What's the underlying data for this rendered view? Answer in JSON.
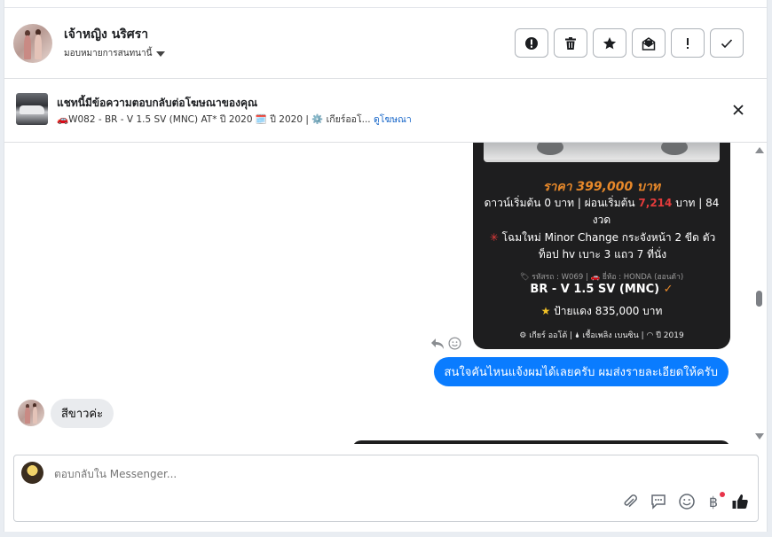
{
  "header": {
    "name": "เจ้าหญิง นริศรา",
    "assign_label": "มอบหมายการสนทนานี้",
    "actions": [
      {
        "icon": "alert-circle-icon"
      },
      {
        "icon": "trash-icon"
      },
      {
        "icon": "star-icon"
      },
      {
        "icon": "mark-unread-icon"
      },
      {
        "icon": "exclamation-icon"
      },
      {
        "icon": "check-icon"
      }
    ]
  },
  "ad_banner": {
    "title": "แชทนี้มีข้อความตอบกลับต่อโฆษณาของคุณ",
    "details": "🚗W082 - BR - V 1.5 SV (MNC) AT* ปี 2020 🗓️ ปี 2020 | ⚙️ เกียร์ออโ...",
    "link": "ดูโฆษณา"
  },
  "card": {
    "price": "ราคา 399,000 บาท",
    "down_prefix": "ดาวน์เริ่มต้น 0 บาท | ผ่อนเริ่มต้น ",
    "installment": "7,214",
    "down_suffix": " บาท | 84 งวด",
    "star_mark": "✳",
    "feature": " โฉมใหม่ Minor Change กระจังหน้า 2 ขีด ตัวท็อป hv เบาะ 3 แถว 7 ที่นั่ง",
    "meta": "🏷 รหัสรถ : W069 | 🚗 ยี่ห้อ : HONDA (ฮอนด้า)",
    "model": "BR - V 1.5 SV (MNC)",
    "model_mark": "✓",
    "plate_star": "★",
    "plate": " ป้ายแดง 835,000 บาท",
    "specs": "⚙ เกียร์ ออโต้  |  🌢 เชื้อเพลิง เบนซิน  |  ◠ ปี 2019"
  },
  "messages": {
    "outgoing": "สนใจคันไหนแจ้งผมได้เลยครับ ผมส่งรายละเอียดให้ครับ",
    "incoming": "สีขาวค่ะ"
  },
  "composer": {
    "placeholder": "ตอบกลับใน Messenger...",
    "icons": [
      "attachment-icon",
      "saved-reply-icon",
      "emoji-icon",
      "baht-icon",
      "thumbs-up-icon"
    ],
    "baht_symbol": "฿"
  },
  "colors": {
    "accent": "#0a7cff",
    "price": "#e8892a",
    "installment_red": "#e23b3b",
    "link": "#1867c9"
  }
}
